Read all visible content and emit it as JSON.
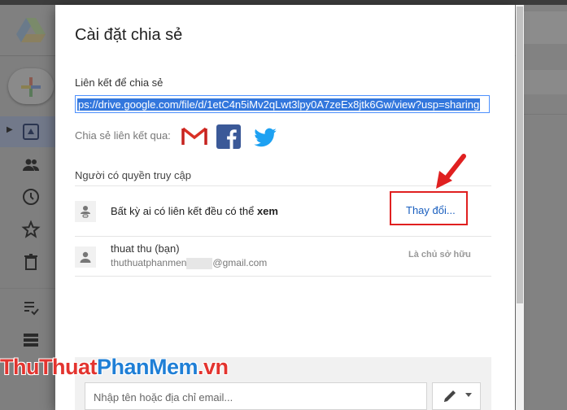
{
  "dialog": {
    "title": "Cài đặt chia sẻ",
    "link_label": "Liên kết để chia sẻ",
    "link_value": "ps://drive.google.com/file/d/1etC4n5iMv2qLwt3lpy0A7zeEx8jtk6Gw/view?usp=sharing",
    "share_via_label": "Chia sẻ liên kết qua:",
    "share_icons": [
      "gmail-icon",
      "facebook-icon",
      "twitter-icon"
    ],
    "access_title": "Người có quyền truy cập",
    "anyone": {
      "text_prefix": "Bất kỳ ai có liên kết đều có thể",
      "text_bold": "xem",
      "change_label": "Thay đổi..."
    },
    "owner": {
      "name": "thuat thu (bạn)",
      "email_prefix": "thuthuatphanmen",
      "email_suffix": "@gmail.com",
      "role": "Là chủ sở hữu"
    },
    "invite": {
      "placeholder": "Nhập tên hoặc địa chỉ email...",
      "permission_icon": "pencil-icon"
    }
  },
  "watermark": {
    "part1": "Thu",
    "part2": "Thuat",
    "part3": "Phan",
    "part4": "Mem",
    "part5": ".vn"
  },
  "colors": {
    "accent_blue": "#1a5fbf",
    "highlight_red": "#e02020",
    "selection_blue": "#3377dd"
  }
}
